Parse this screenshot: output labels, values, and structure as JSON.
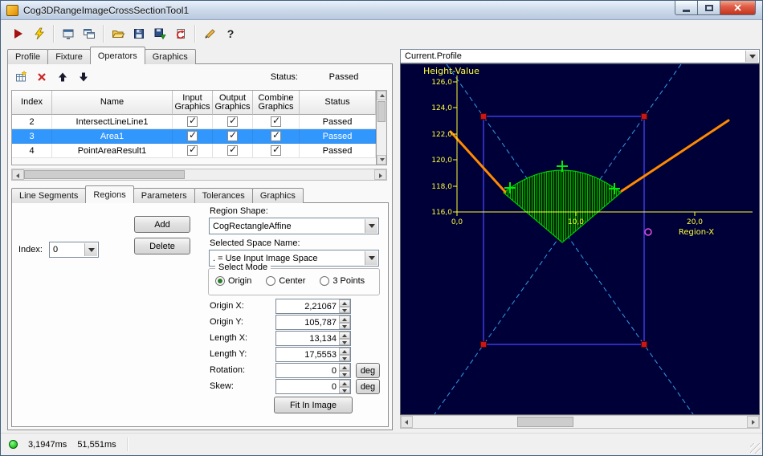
{
  "window": {
    "title": "Cog3DRangeImageCrossSectionTool1"
  },
  "toolbar": {
    "icons": [
      {
        "name": "run-icon"
      },
      {
        "name": "run-continuous-icon"
      },
      {
        "name": "result-display-icon"
      },
      {
        "name": "float-display-icon"
      },
      {
        "name": "open-file-icon"
      },
      {
        "name": "save-file-icon"
      },
      {
        "name": "save-image-icon"
      },
      {
        "name": "reset-tool-icon"
      },
      {
        "name": "edit-graphics-icon"
      },
      {
        "name": "help-icon",
        "glyph": "?"
      }
    ]
  },
  "main_tabs": {
    "items": [
      {
        "label": "Profile"
      },
      {
        "label": "Fixture"
      },
      {
        "label": "Operators"
      },
      {
        "label": "Graphics"
      }
    ],
    "active_index": 2
  },
  "operators": {
    "status_label": "Status:",
    "status_value": "Passed",
    "table": {
      "columns": [
        "Index",
        "Name",
        "Input Graphics",
        "Output Graphics",
        "Combine Graphics",
        "Status"
      ],
      "rows": [
        {
          "index": "2",
          "name": "IntersectLineLine1",
          "input_graphics": true,
          "output_graphics": true,
          "combine_graphics": true,
          "status": "Passed",
          "selected": false
        },
        {
          "index": "3",
          "name": "Area1",
          "input_graphics": true,
          "output_graphics": true,
          "combine_graphics": true,
          "status": "Passed",
          "selected": true
        },
        {
          "index": "4",
          "name": "PointAreaResult1",
          "input_graphics": true,
          "output_graphics": true,
          "combine_graphics": true,
          "status": "Passed",
          "selected": false
        }
      ]
    }
  },
  "sub_tabs": {
    "items": [
      {
        "label": "Line Segments"
      },
      {
        "label": "Regions"
      },
      {
        "label": "Parameters"
      },
      {
        "label": "Tolerances"
      },
      {
        "label": "Graphics"
      }
    ],
    "active_index": 1
  },
  "region_form": {
    "index_label": "Index:",
    "index_value": "0",
    "add_button": "Add",
    "delete_button": "Delete",
    "region_shape_label": "Region Shape:",
    "region_shape_value": "CogRectangleAffine",
    "space_name_label": "Selected Space Name:",
    "space_name_value": ". = Use Input Image Space",
    "select_mode_label": "Select Mode",
    "modes": [
      {
        "label": "Origin",
        "selected": true
      },
      {
        "label": "Center",
        "selected": false
      },
      {
        "label": "3 Points",
        "selected": false
      }
    ],
    "fields": [
      {
        "label": "Origin X:",
        "value": "2,21067"
      },
      {
        "label": "Origin Y:",
        "value": "105,787"
      },
      {
        "label": "Length X:",
        "value": "13,134"
      },
      {
        "label": "Length Y:",
        "value": "17,5553"
      },
      {
        "label": "Rotation:",
        "value": "0",
        "unit": "deg"
      },
      {
        "label": "Skew:",
        "value": "0",
        "unit": "deg"
      }
    ],
    "fit_button": "Fit In Image"
  },
  "profile_panel": {
    "combo_value": "Current.Profile"
  },
  "chart_data": {
    "type": "line",
    "title": "",
    "ylabel": "Height-Value",
    "xlabel": "Region-X",
    "xlim": [
      0,
      20
    ],
    "ylim": [
      116,
      126
    ],
    "y_ticks": [
      "126,0",
      "124,0",
      "122,0",
      "120,0",
      "118,0",
      "116,0"
    ],
    "x_ticks": [
      "0,0",
      "10,0",
      "20,0"
    ],
    "background": "#000038",
    "axis_color": "#ffff33",
    "grid": false,
    "series": [
      {
        "name": "profile-left",
        "color": "#ff8a00",
        "points": [
          [
            -0.4,
            122.2
          ],
          [
            4.0,
            117.5
          ]
        ]
      },
      {
        "name": "profile-right",
        "color": "#ff8a00",
        "points": [
          [
            13.6,
            117.6
          ],
          [
            22.2,
            123.1
          ]
        ]
      }
    ],
    "area_sector": {
      "name": "Area1-hatched-sector",
      "color": "#00c000",
      "apex": [
        8.6,
        113.7
      ],
      "arc_from": [
        3.8,
        117.5
      ],
      "arc_peak": [
        8.6,
        120.5
      ],
      "arc_to": [
        13.4,
        117.5
      ]
    },
    "region_rect": {
      "x": 2.21067,
      "y": 105.787,
      "length_x": 13.134,
      "length_y": 17.5553,
      "color": "#3a3ae0",
      "handle_color": "#cc1515"
    },
    "markers": [
      {
        "name": "cross-left",
        "shape": "plus",
        "color": "#00ee00",
        "x": 4.3,
        "y": 117.9
      },
      {
        "name": "cross-top",
        "shape": "plus",
        "color": "#00ee00",
        "x": 8.6,
        "y": 119.6
      },
      {
        "name": "cross-right",
        "shape": "plus",
        "color": "#00ee00",
        "x": 12.9,
        "y": 117.8
      },
      {
        "name": "point-result",
        "shape": "circle",
        "color": "#e050e0",
        "x": 15.7,
        "y": 114.5
      }
    ],
    "diagonal_guides": {
      "color": "#2f9fe8",
      "style": "dashed"
    }
  },
  "status_bar": {
    "run_time": "3,1947ms",
    "total_time": "51,551ms"
  }
}
